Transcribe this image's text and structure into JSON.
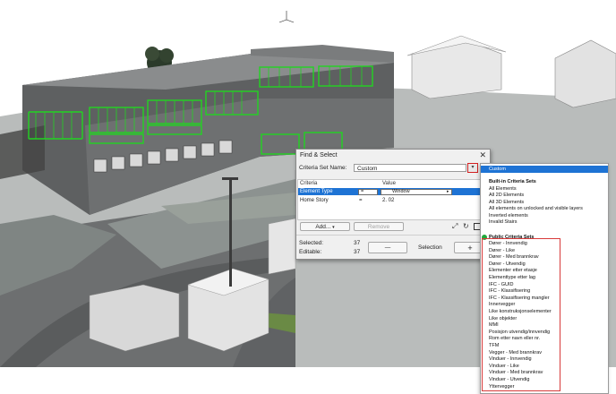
{
  "dialog": {
    "title": "Find & Select",
    "close_glyph": "✕",
    "criteria_set_label": "Criteria Set Name:",
    "criteria_set_value": "Custom",
    "columns": {
      "criteria": "Criteria",
      "value": "Value"
    },
    "rows": [
      {
        "criteria": "Element Type",
        "operator": "=",
        "value": "Window"
      },
      {
        "criteria": "Home Story",
        "operator": "=",
        "value": "2. 02"
      }
    ],
    "add_label": "Add...",
    "remove_label": "Remove",
    "selected_label": "Selected:",
    "selected_value": "37",
    "editable_label": "Editable:",
    "editable_value": "37",
    "minus_label": "—",
    "selection_label": "Selection",
    "plus_label": "+"
  },
  "dropdown": {
    "custom": "Custom",
    "builtin_title": "Built-in Criteria Sets",
    "builtin": [
      "All Elements",
      "All 2D Elements",
      "All 3D Elements",
      "All elements on unlocked and visible layers",
      "Inverted elements",
      "Invalid Stairs"
    ],
    "public_title": "Public Criteria Sets",
    "public": [
      "Dører - Innvendig",
      "Dører - Like",
      "Dører - Med brannkrav",
      "Dører - Utvendig",
      "Elementer etter etasje",
      "Elementtype etter lag",
      "IFC - GUID",
      "IFC - Klassifisering",
      "IFC - Klassifisering mangler",
      "Innervegger",
      "Like konstruksjonselementer",
      "Like objekter",
      "MMI",
      "Posisjon utvendig/innvendig",
      "Rom etter navn eller nr.",
      "TFM",
      "Vegger - Med brannkrav",
      "Vinduer - Innvendig",
      "Vinduer - Like",
      "Vinduer - Med brannkrav",
      "Vinduer - Utvendig",
      "Yttervegger"
    ]
  },
  "colors": {
    "selection": "#1e73d4",
    "highlight_red": "#d83a3a",
    "window_green": "#22d422"
  }
}
